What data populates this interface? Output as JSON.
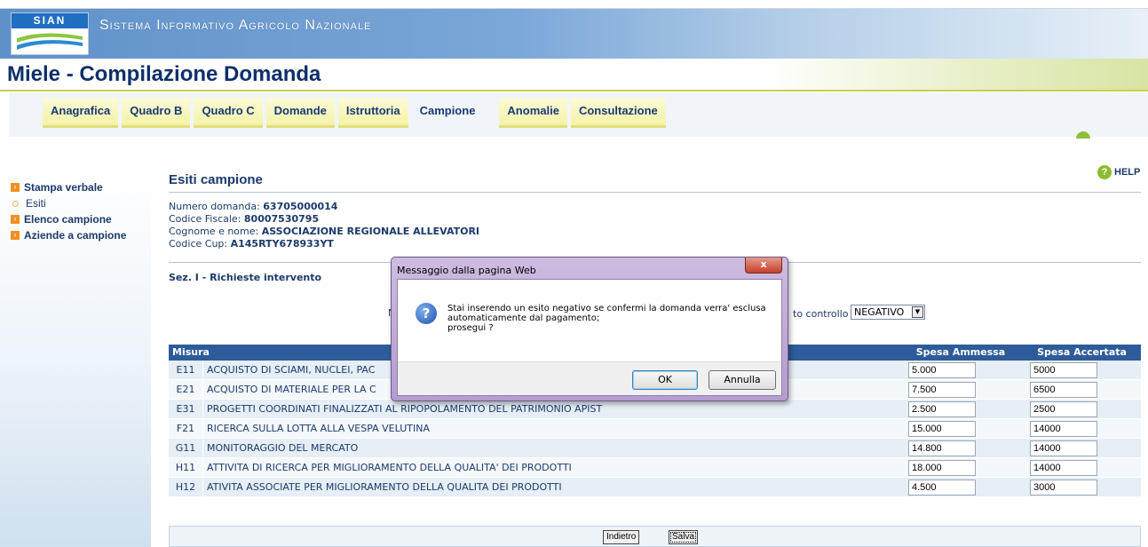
{
  "header": {
    "logo_text": "SIAN",
    "system_title": "Sistema Informativo Agricolo Nazionale",
    "app_title": "Miele - Compilazione Domanda"
  },
  "tabs": [
    {
      "label": "Anagrafica"
    },
    {
      "label": "Quadro B"
    },
    {
      "label": "Quadro C"
    },
    {
      "label": "Domande"
    },
    {
      "label": "Istruttoria"
    },
    {
      "label": "Campione"
    },
    {
      "label": "Anomalie"
    },
    {
      "label": "Consultazione"
    }
  ],
  "sidebar": {
    "items": [
      {
        "label": "Stampa verbale"
      },
      {
        "label": "Esiti"
      },
      {
        "label": "Elenco campione"
      },
      {
        "label": "Aziende a campione"
      }
    ]
  },
  "help_label": "HELP",
  "main": {
    "title": "Esiti campione",
    "numero_domanda_label": "Numero domanda:",
    "numero_domanda": "63705000014",
    "codice_fiscale_label": "Codice Fiscale:",
    "codice_fiscale": "80007530795",
    "cognome_nome_label": "Cognome e nome:",
    "cognome_nome": "ASSOCIAZIONE REGIONALE ALLEVATORI",
    "codice_cup_label": "Codice Cup:",
    "codice_cup": "A145RTY678933YT",
    "section_title": "Sez. I - Richieste intervento",
    "esito_label_partial": "to controllo",
    "esito_value": "NEGATIVO",
    "hidden_partial": "N"
  },
  "table": {
    "headers": {
      "misura": "Misura",
      "spesa_ammessa": "Spesa Ammessa",
      "spesa_accertata": "Spesa Accertata"
    },
    "rows": [
      {
        "code": "E11",
        "desc": "ACQUISTO DI SCIAMI, NUCLEI, PAC",
        "ammessa": "5.000",
        "accertata": "5000"
      },
      {
        "code": "E21",
        "desc": "ACQUISTO DI MATERIALE PER LA C",
        "ammessa": "7.500",
        "accertata": "6500"
      },
      {
        "code": "E31",
        "desc": "PROGETTI COORDINATI FINALIZZATI AL RIPOPOLAMENTO DEL PATRIMONIO APIST",
        "ammessa": "2.500",
        "accertata": "2500"
      },
      {
        "code": "F21",
        "desc": "RICERCA SULLA LOTTA ALLA VESPA VELUTINA",
        "ammessa": "15.000",
        "accertata": "14000"
      },
      {
        "code": "G11",
        "desc": "MONITORAGGIO DEL MERCATO",
        "ammessa": "14.800",
        "accertata": "14000"
      },
      {
        "code": "H11",
        "desc": "ATTIVITA DI RICERCA PER MIGLIORAMENTO DELLA QUALITA' DEI PRODOTTI",
        "ammessa": "18.000",
        "accertata": "14000"
      },
      {
        "code": "H12",
        "desc": "ATIVITA ASSOCIATE PER MIGLIORAMENTO DELLA QUALITA DEI PRODOTTI",
        "ammessa": "4.500",
        "accertata": "3000"
      }
    ]
  },
  "footer": {
    "back_label": "Indietro",
    "save_label": "Salva"
  },
  "dialog": {
    "title": "Messaggio dalla pagina Web",
    "close_label": "x",
    "message_line1": "Stai inserendo un esito negativo se confermi la domanda verra' esclusa",
    "message_line2": "automaticamente dal pagamento;",
    "message_line3": "prosegui ?",
    "ok_label": "OK",
    "cancel_label": "Annulla"
  },
  "colors": {
    "accent": "#2e5c9a",
    "tab_bg": "#f4f2a8",
    "header_band": "#5f91c9"
  }
}
